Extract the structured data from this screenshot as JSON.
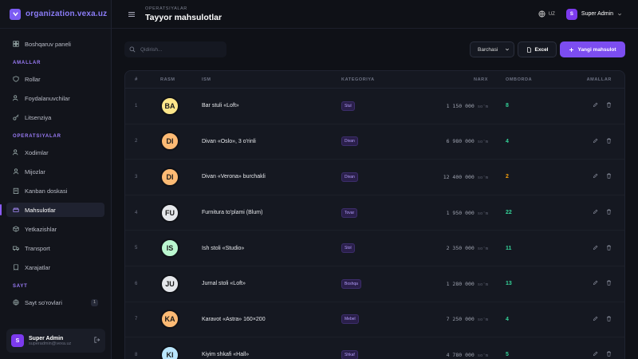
{
  "brand": {
    "name": "organization.vexa.uz"
  },
  "sidebar": {
    "top_item": "Boshqaruv paneli",
    "sections": [
      {
        "title": "AMALLAR",
        "items": [
          "Rollar",
          "Foydalanuvchilar",
          "Litsenziya"
        ]
      },
      {
        "title": "OPERATSIYALAR",
        "items": [
          "Xodimlar",
          "Mijozlar",
          "Kanban doskasi",
          "Mahsulotlar",
          "Yetkazishlar",
          "Transport",
          "Xarajatlar"
        ]
      },
      {
        "title": "SAYT",
        "items": [
          "Sayt so'rovlari"
        ]
      }
    ],
    "site_requests_count": "1",
    "user": {
      "initial": "S",
      "name": "Super Admin",
      "email": "superadmin@vexa.uz"
    }
  },
  "header": {
    "breadcrumb": "OPERATSIYALAR",
    "title": "Tayyor mahsulotlar",
    "lang": "UZ",
    "user_initial": "S",
    "user_name": "Super Admin"
  },
  "toolbar": {
    "search_placeholder": "Qidirish...",
    "filter_value": "Barchasi",
    "excel_label": "Excel",
    "new_label": "Yangi mahsulot"
  },
  "table": {
    "columns": {
      "num": "#",
      "rasm": "RASM",
      "ism": "ISM",
      "kategoriya": "KATEGORIYA",
      "narx": "NARX",
      "omborda": "OMBORDA",
      "amallar": "AMALLAR"
    },
    "currency": "so'm",
    "rows": [
      {
        "num": "1",
        "initials": "BA",
        "name": "Bar stuli «Loft»",
        "category": "Stul",
        "price": "1 150 000",
        "stock": "8",
        "avatar_color": "#fde68a",
        "stock_color": "#34d399"
      },
      {
        "num": "2",
        "initials": "DI",
        "name": "Divan «Oslo», 3 o'rinli",
        "category": "Divan",
        "price": "6 980 000",
        "stock": "4",
        "avatar_color": "#fdba74",
        "stock_color": "#34d399"
      },
      {
        "num": "3",
        "initials": "DI",
        "name": "Divan «Verona» burchakli",
        "category": "Divan",
        "price": "12 400 000",
        "stock": "2",
        "avatar_color": "#fdba74",
        "stock_color": "#f59e0b"
      },
      {
        "num": "4",
        "initials": "FU",
        "name": "Furnitura to'plami (Blum)",
        "category": "Tovar",
        "price": "1 950 000",
        "stock": "22",
        "avatar_color": "#e5e7eb",
        "stock_color": "#34d399"
      },
      {
        "num": "5",
        "initials": "IS",
        "name": "Ish stoli «Studio»",
        "category": "Stol",
        "price": "2 350 000",
        "stock": "11",
        "avatar_color": "#bbf7d0",
        "stock_color": "#34d399"
      },
      {
        "num": "6",
        "initials": "JU",
        "name": "Jurnal stoli «Loft»",
        "category": "Boshqa",
        "price": "1 280 000",
        "stock": "13",
        "avatar_color": "#e5e7eb",
        "stock_color": "#34d399"
      },
      {
        "num": "7",
        "initials": "KA",
        "name": "Karavot «Astra» 160×200",
        "category": "Mebel",
        "price": "7 250 000",
        "stock": "4",
        "avatar_color": "#fdba74",
        "stock_color": "#34d399"
      },
      {
        "num": "8",
        "initials": "KI",
        "name": "Kiyim shkafi «Hall»",
        "category": "Shkaf",
        "price": "4 780 000",
        "stock": "5",
        "avatar_color": "#bae6fd",
        "stock_color": "#34d399"
      }
    ]
  }
}
